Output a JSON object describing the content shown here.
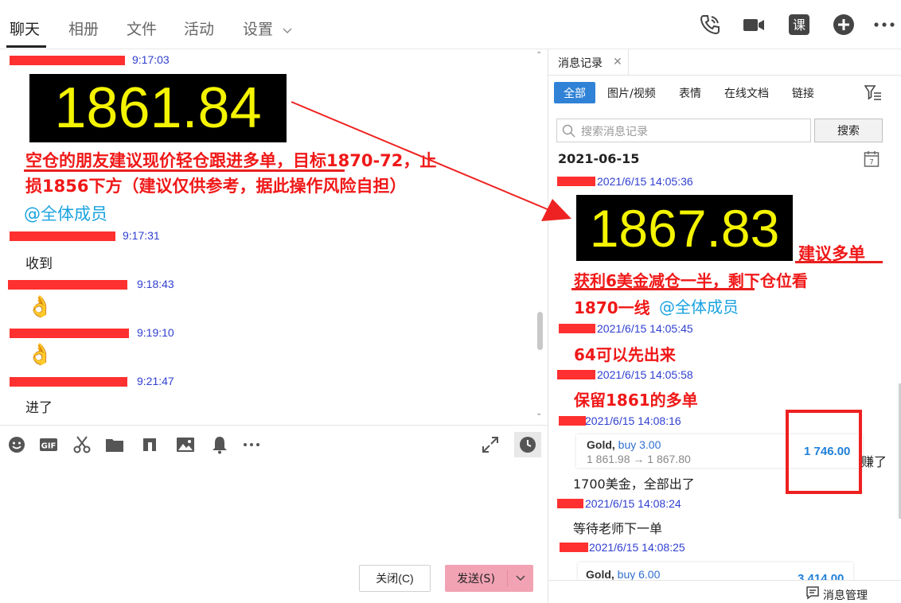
{
  "top_tabs": [
    "聊天",
    "相册",
    "文件",
    "活动",
    "设置"
  ],
  "chat": {
    "messages": [
      {
        "time": "9:17:03",
        "price": "1861.84",
        "text": "空仓的朋友建议现价轻仓跟进多单，目标1870-72，止",
        "text2": "损1856下方（建议仅供参考，据此操作风险自担）",
        "mention": "@全体成员"
      },
      {
        "time": "9:17:31",
        "text": "收到"
      },
      {
        "time": "9:18:43",
        "emoji": "👌"
      },
      {
        "time": "9:19:10",
        "emoji": "👌"
      },
      {
        "time": "9:21:47",
        "text": "进了"
      }
    ]
  },
  "buttons": {
    "close": "关闭(C)",
    "send": "发送(S)"
  },
  "history": {
    "tab_label": "消息记录",
    "filters": [
      "全部",
      "图片/视频",
      "表情",
      "在线文档",
      "链接"
    ],
    "search_placeholder": "搜索消息记录",
    "search_button": "搜索",
    "date": "2021-06-15",
    "entries": [
      {
        "time": "2021/6/15 14:05:36",
        "price": "1867.83",
        "tag": "建议多单",
        "line1": "获利6美金减仓一半，剩下仓位看",
        "line2": "1870一线",
        "mention": "@全体成员"
      },
      {
        "time": "2021/6/15 14:05:45",
        "text": "64可以先出来"
      },
      {
        "time": "2021/6/15 14:05:58",
        "text": "保留1861的多单"
      },
      {
        "time": "2021/6/15 14:08:16",
        "card_title": "Gold,",
        "card_buy": "buy 3.00",
        "card_range": "1 861.98 → 1 867.80",
        "card_profit": "1 746.00",
        "suffix": "赚了",
        "text": "1700美金，全部出了"
      },
      {
        "time": "2021/6/15 14:08:24",
        "text": "等待老师下一单"
      },
      {
        "time": "2021/6/15 14:08:25",
        "card_title": "Gold,",
        "card_buy": "buy 6.00",
        "card_profit": "3 414.00"
      }
    ],
    "footer": "消息管理"
  },
  "colors": {
    "accent_blue": "#2f82d6",
    "alert_red": "#f01818",
    "price_yellow": "#f4f400",
    "time_blue": "#2f3fd0"
  }
}
